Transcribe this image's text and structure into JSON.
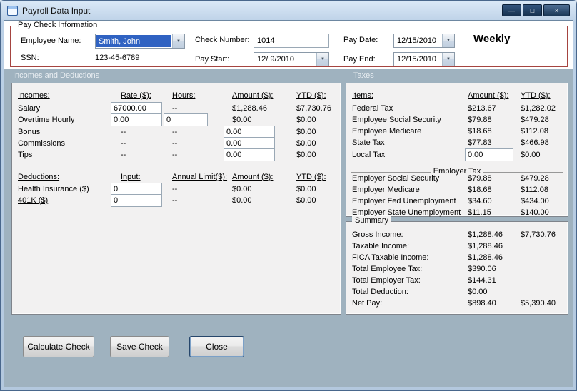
{
  "window": {
    "title": "Payroll Data Input"
  },
  "icons": {
    "minimize": "—",
    "maximize": "□",
    "close": "×",
    "dropdown": "▼"
  },
  "paycheck": {
    "group_title": "Pay Check Information",
    "fields": {
      "employee_name": {
        "label": "Employee Name:",
        "value": "Smith, John"
      },
      "ssn": {
        "label": "SSN:",
        "value": "123-45-6789"
      },
      "check_number": {
        "label": "Check Number:",
        "value": "1014"
      },
      "pay_start": {
        "label": "Pay Start:",
        "value": "12/ 9/2010"
      },
      "pay_date": {
        "label": "Pay Date:",
        "value": "12/15/2010"
      },
      "pay_end": {
        "label": "Pay End:",
        "value": "12/15/2010"
      }
    },
    "frequency": "Weekly"
  },
  "section_headers": {
    "incomes": "Incomes and Deductions",
    "taxes": "Taxes"
  },
  "incomes": {
    "headers": {
      "col1": "Incomes:",
      "col2": "Rate ($):",
      "col3": "Hours:",
      "col4": "Amount ($):",
      "col5": "YTD ($):"
    },
    "rows": {
      "salary": {
        "label": "Salary",
        "rate": "67000.00",
        "hours": "--",
        "amount": "$1,288.46",
        "ytd": "$7,730.76"
      },
      "overtime": {
        "label": "Overtime Hourly",
        "rate": "0.00",
        "hours": "0",
        "amount": "$0.00",
        "ytd": "$0.00"
      },
      "bonus": {
        "label": "Bonus",
        "rate": "--",
        "hours": "--",
        "amount": "0.00",
        "ytd": "$0.00"
      },
      "commissions": {
        "label": "Commissions",
        "rate": "--",
        "hours": "--",
        "amount": "0.00",
        "ytd": "$0.00"
      },
      "tips": {
        "label": "Tips",
        "rate": "--",
        "hours": "--",
        "amount": "0.00",
        "ytd": "$0.00"
      }
    }
  },
  "deductions": {
    "headers": {
      "col1": "Deductions:",
      "col2": "Input:",
      "col3": "Annual Limit($):",
      "col4": "Amount ($):",
      "col5": "YTD ($):"
    },
    "rows": {
      "health": {
        "label": "Health Insurance  ($)",
        "input": "0",
        "limit": "--",
        "amount": "$0.00",
        "ytd": "$0.00"
      },
      "k401": {
        "label": "401K  ($)",
        "input": "0",
        "limit": "--",
        "amount": "$0.00",
        "ytd": "$0.00"
      }
    }
  },
  "taxes": {
    "headers": {
      "col1": "Items:",
      "col2": "Amount ($):",
      "col3": "YTD ($):"
    },
    "employee_rows": [
      {
        "label": "Federal Tax",
        "amount": "$213.67",
        "ytd": "$1,282.02"
      },
      {
        "label": "Employee Social Security",
        "amount": "$79.88",
        "ytd": "$479.28"
      },
      {
        "label": "Employee Medicare",
        "amount": "$18.68",
        "ytd": "$112.08"
      },
      {
        "label": "State Tax",
        "amount": "$77.83",
        "ytd": "$466.98"
      }
    ],
    "local_tax": {
      "label": "Local Tax",
      "amount": "0.00",
      "ytd": "$0.00"
    },
    "employer_divider": "Employer Tax",
    "employer_rows": [
      {
        "label": "Employer Social Security",
        "amount": "$79.88",
        "ytd": "$479.28"
      },
      {
        "label": "Employer Medicare",
        "amount": "$18.68",
        "ytd": "$112.08"
      },
      {
        "label": "Employer Fed Unemployment",
        "amount": "$34.60",
        "ytd": "$434.00"
      },
      {
        "label": "Employer State Unemployment",
        "amount": "$11.15",
        "ytd": "$140.00"
      }
    ]
  },
  "summary": {
    "title": "Summary",
    "rows": [
      {
        "label": "Gross Income:",
        "amount": "$1,288.46",
        "ytd": "$7,730.76"
      },
      {
        "label": "Taxable Income:",
        "amount": "$1,288.46",
        "ytd": ""
      },
      {
        "label": "FICA Taxable Income:",
        "amount": "$1,288.46",
        "ytd": ""
      },
      {
        "label": "Total Employee Tax:",
        "amount": "$390.06",
        "ytd": ""
      },
      {
        "label": "Total Employer Tax:",
        "amount": "$144.31",
        "ytd": ""
      },
      {
        "label": "Total Deduction:",
        "amount": "$0.00",
        "ytd": ""
      },
      {
        "label": "Net Pay:",
        "amount": "$898.40",
        "ytd": "$5,390.40"
      }
    ]
  },
  "buttons": {
    "calculate": "Calculate Check",
    "save": "Save Check",
    "close": "Close"
  },
  "colors": {
    "selection": "#2f62c2",
    "groupbox_border": "#a54440",
    "backdrop": "#9fb2bf"
  }
}
